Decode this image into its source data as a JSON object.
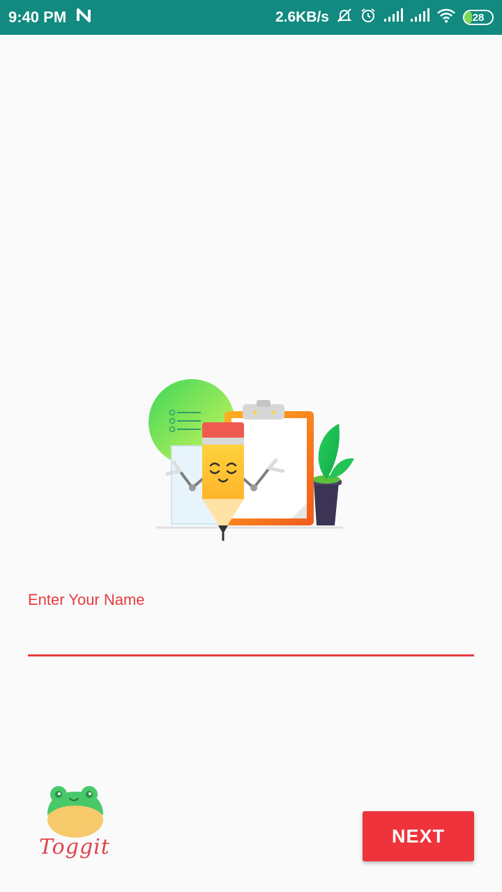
{
  "status_bar": {
    "time": "9:40 PM",
    "network_speed": "2.6KB/s",
    "battery_level": "28",
    "battery_fraction": 0.28,
    "icons": [
      "n-notification-icon",
      "notifications-off-icon",
      "alarm-icon",
      "signal-icon",
      "signal-icon",
      "wifi-icon",
      "battery-icon"
    ]
  },
  "form": {
    "name_label": "Enter Your Name",
    "name_value": "",
    "accent_color": "#e53b3e"
  },
  "logo": {
    "text": "Toggit"
  },
  "actions": {
    "next_label": "NEXT",
    "button_color": "#ee333c"
  },
  "colors": {
    "status_bar": "#128a80",
    "background": "#fafafa"
  }
}
